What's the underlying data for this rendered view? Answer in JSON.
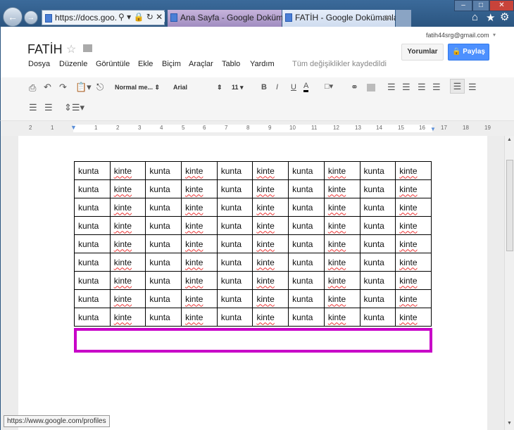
{
  "browser": {
    "address": "https://docs.goo...",
    "tabs": [
      {
        "label": "Ana Sayfa - Google Dokümanlar"
      },
      {
        "label": "FATİH - Google Dokümanlar"
      }
    ],
    "status_url": "https://www.google.com/profiles"
  },
  "doc": {
    "title": "FATİH",
    "account": "fatih44srg@gmail.com",
    "comments_label": "Yorumlar",
    "share_label": "Paylaş",
    "share_color": "#4d90fe",
    "save_status": "Tüm değişiklikler kaydedildi"
  },
  "menu": [
    "Dosya",
    "Düzenle",
    "Görüntüle",
    "Ekle",
    "Biçim",
    "Araçlar",
    "Tablo",
    "Yardım"
  ],
  "toolbar": {
    "style": "Normal me...",
    "font": "Arial",
    "size": "11"
  },
  "ruler": [
    "2",
    "1",
    "1",
    "2",
    "3",
    "4",
    "5",
    "6",
    "7",
    "8",
    "9",
    "10",
    "11",
    "12",
    "13",
    "14",
    "15",
    "16",
    "17",
    "18",
    "19"
  ],
  "table": {
    "rows": [
      [
        "kunta",
        "kinte",
        "kunta",
        "kinte",
        "kunta",
        "kinte",
        "kunta",
        "kinte",
        "kunta",
        "kinte"
      ],
      [
        "kunta",
        "kinte",
        "kunta",
        "kinte",
        "kunta",
        "kinte",
        "kunta",
        "kinte",
        "kunta",
        "kinte"
      ],
      [
        "kunta",
        "kinte",
        "kunta",
        "kinte",
        "kunta",
        "kinte",
        "kunta",
        "kinte",
        "kunta",
        "kinte"
      ],
      [
        "kunta",
        "kinte",
        "kunta",
        "kinte",
        "kunta",
        "kinte",
        "kunta",
        "kinte",
        "kunta",
        "kinte"
      ],
      [
        "kunta",
        "kinte",
        "kunta",
        "kinte",
        "kunta",
        "kinte",
        "kunta",
        "kinte",
        "kunta",
        "kinte"
      ],
      [
        "kunta",
        "kinte",
        "kunta",
        "kinte",
        "kunta",
        "kinte",
        "kunta",
        "kinte",
        "kunta",
        "kinte"
      ],
      [
        "kunta",
        "kinte",
        "kunta",
        "kinte",
        "kunta",
        "kinte",
        "kunta",
        "kinte",
        "kunta",
        "kinte"
      ],
      [
        "kunta",
        "kinte",
        "kunta",
        "kinte",
        "kunta",
        "kinte",
        "kunta",
        "kinte",
        "kunta",
        "kinte"
      ],
      [
        "kunta",
        "kinte",
        "kunta",
        "kinte",
        "kunta",
        "kinte",
        "kunta",
        "kinte",
        "kunta",
        "kinte"
      ]
    ]
  },
  "highlight_color": "#c800c8"
}
